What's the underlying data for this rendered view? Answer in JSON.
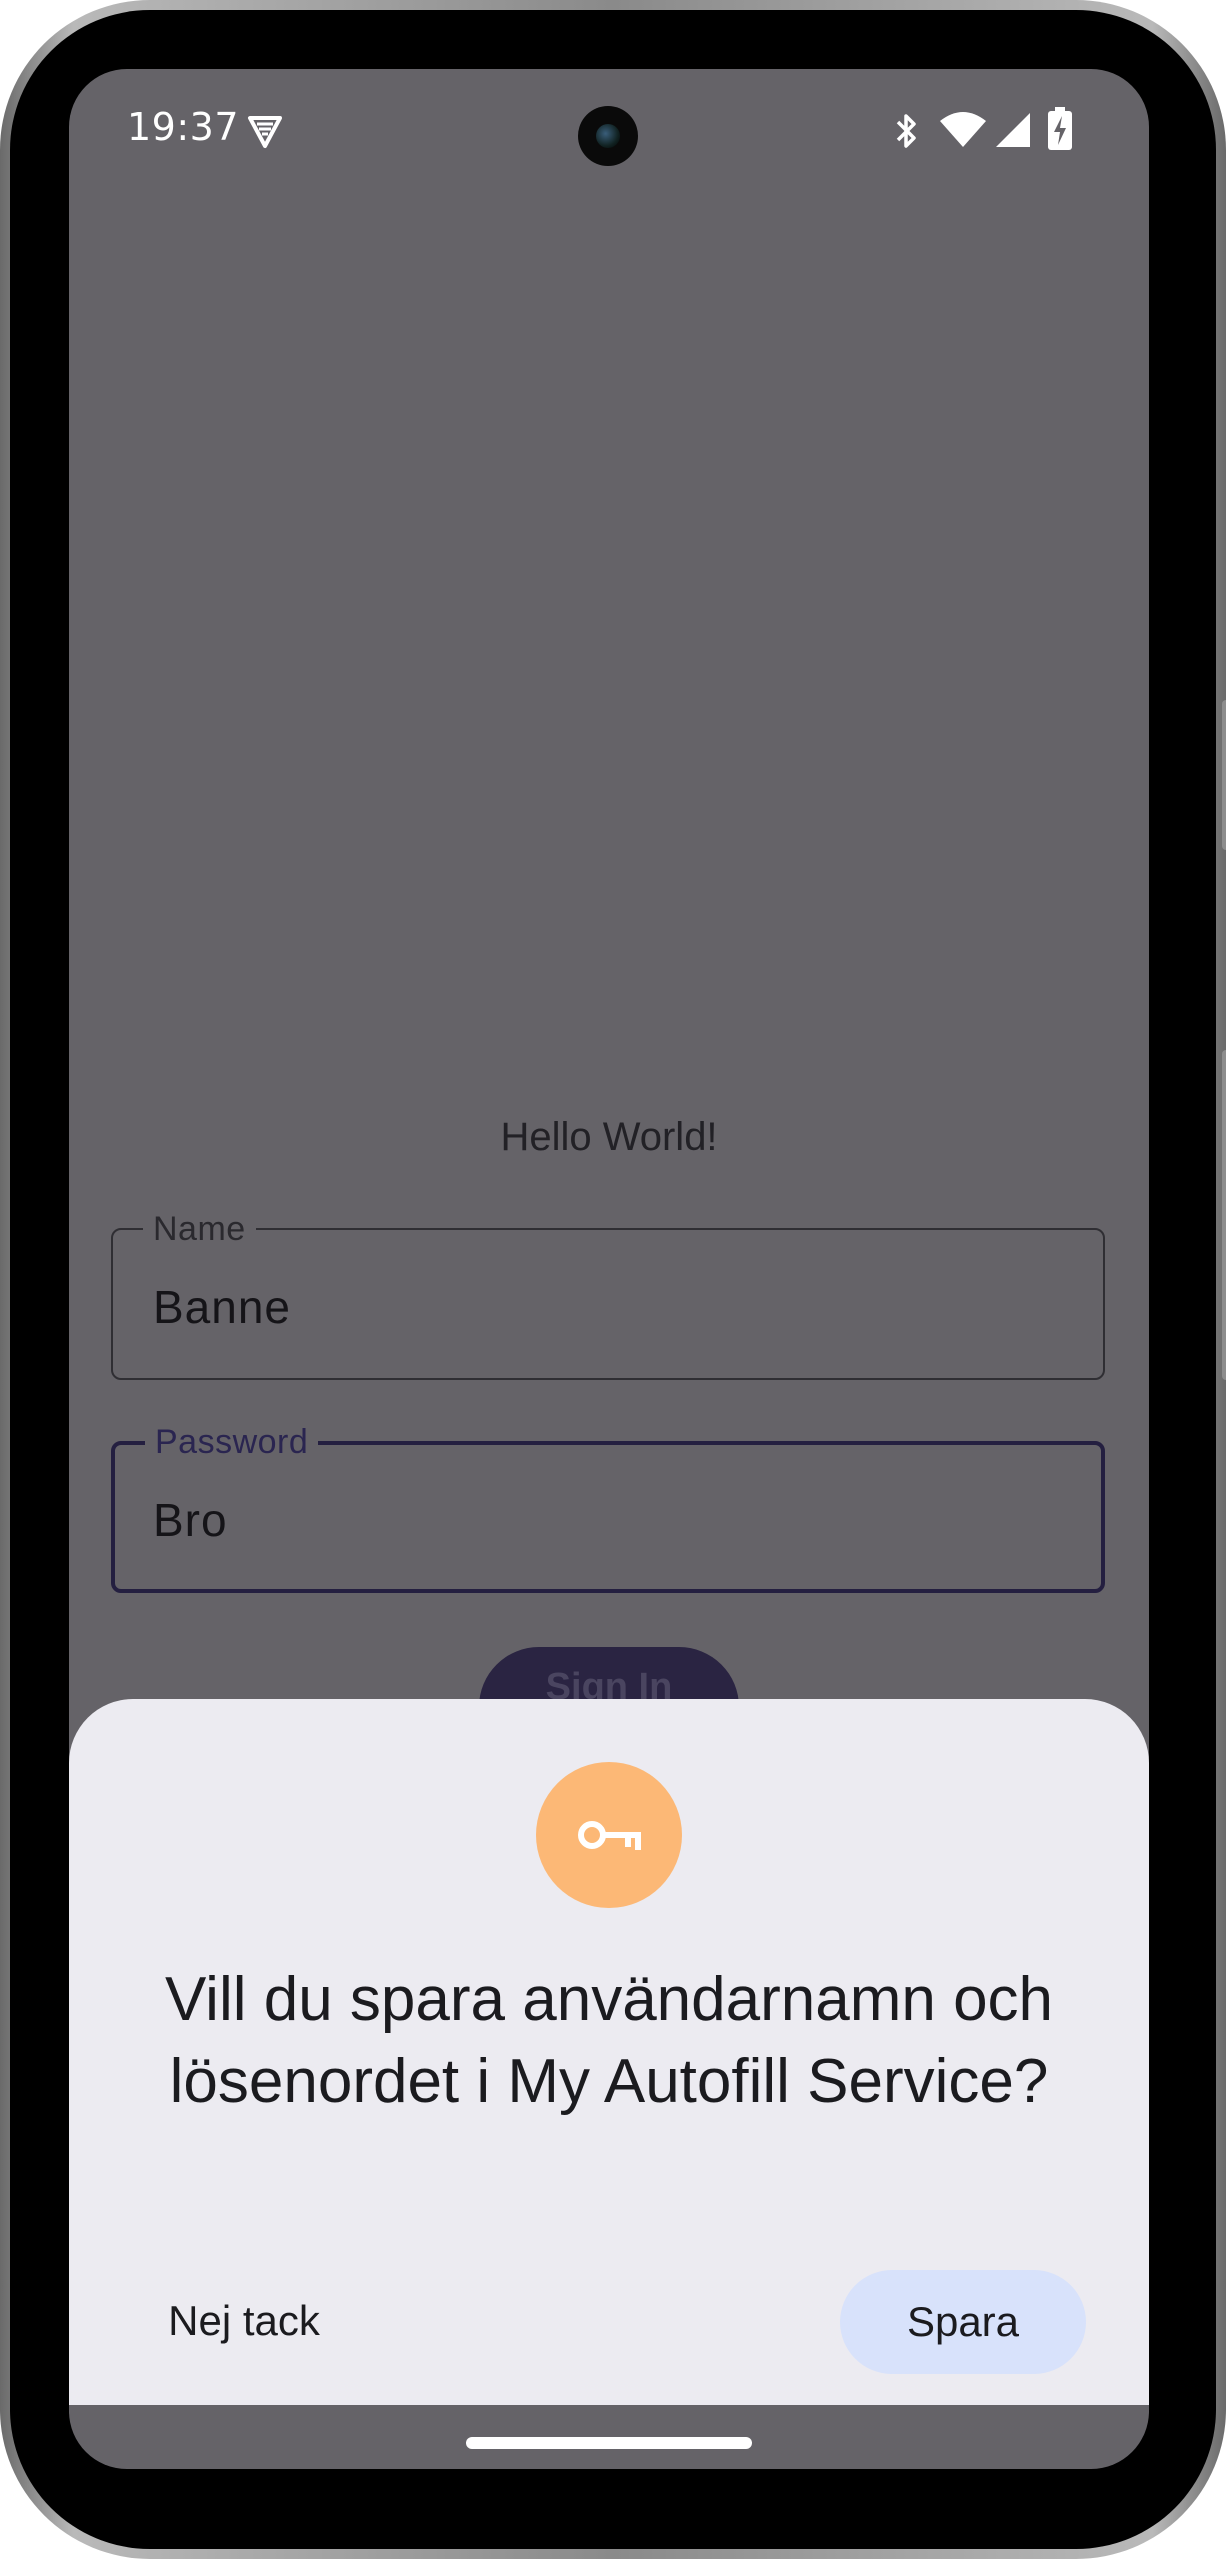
{
  "status_bar": {
    "time": "19:37",
    "icons": [
      "vpn-shield-icon",
      "bluetooth-icon",
      "wifi-icon",
      "cellular-signal-icon",
      "battery-charging-icon"
    ]
  },
  "app": {
    "greeting": "Hello World!",
    "name_field": {
      "label": "Name",
      "value": "Banne"
    },
    "password_field": {
      "label": "Password",
      "value": "Bro"
    },
    "signin_label": "Sign In"
  },
  "save_dialog": {
    "icon": "key-icon",
    "accent_color": "#fcb876",
    "title": "Vill du spara användarnamn och lösenordet i My Autofill Service?",
    "decline_label": "Nej tack",
    "save_label": "Spara"
  }
}
